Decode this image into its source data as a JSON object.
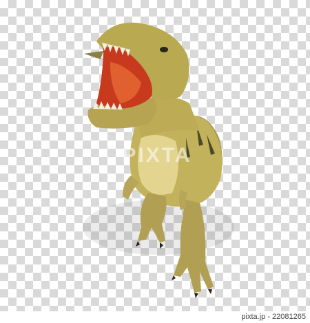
{
  "image": {
    "subject": "tyrannosaurus",
    "background": "transparency-checkerboard",
    "colors": {
      "skin": "#b9a951",
      "skin_light": "#e3d48f",
      "stripes": "#4a4a2a",
      "mouth": "#c73a1e",
      "teeth": "#f4efe0",
      "claws": "#2b2418"
    }
  },
  "watermark": {
    "text": "PIXTA"
  },
  "footer": {
    "caption": "pixta.jp - 22081265"
  }
}
